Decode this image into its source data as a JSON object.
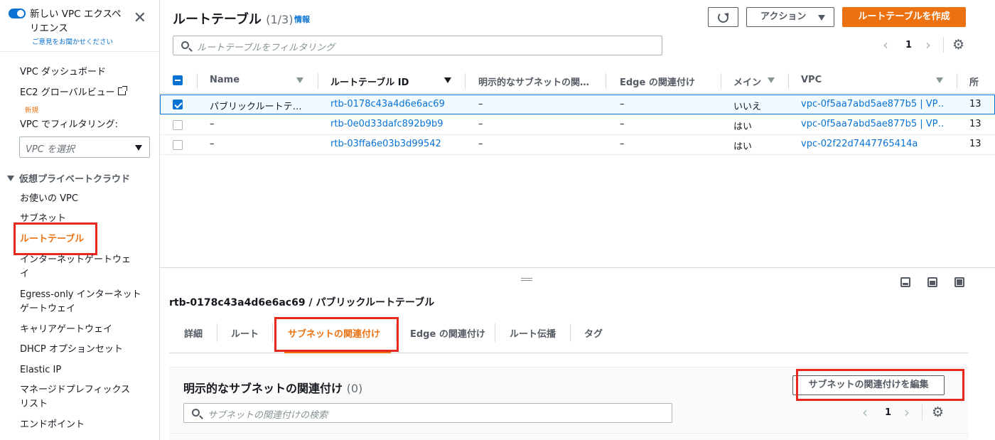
{
  "sidebar": {
    "new_experience_label": "新しい VPC エクスペリエンス",
    "feedback_link": "ご意見をお聞かせください",
    "close_glyph": "✕",
    "dashboard": "VPC ダッシュボード",
    "ec2_global_view": "EC2 グローバルビュー",
    "new_badge": "新規",
    "filter_label": "VPC でフィルタリング:",
    "vpc_select_placeholder": "VPC を選択",
    "section_title": "仮想プライベートクラウド",
    "items": [
      {
        "label": "お使いの VPC"
      },
      {
        "label": "サブネット"
      },
      {
        "label": "ルートテーブル",
        "active": true
      },
      {
        "label": "インターネットゲートウェイ"
      },
      {
        "label": "Egress-only インターネットゲートウェイ"
      },
      {
        "label": "キャリアゲートウェイ"
      },
      {
        "label": "DHCP オプションセット"
      },
      {
        "label": "Elastic IP"
      },
      {
        "label": "マネージドプレフィックスリスト"
      },
      {
        "label": "エンドポイント"
      }
    ]
  },
  "header": {
    "title": "ルートテーブル",
    "count": "(1/3)",
    "info_link": "情報",
    "actions_label": "アクション",
    "create_label": "ルートテーブルを作成",
    "search_placeholder": "ルートテーブルをフィルタリング",
    "page": "1"
  },
  "table": {
    "columns": [
      "Name",
      "ルートテーブル ID",
      "明示的なサブネットの関…",
      "Edge の関連付け",
      "メイン",
      "VPC",
      "所"
    ],
    "rows": [
      {
        "selected": true,
        "name": "パブリックルートテ…",
        "id": "rtb-0178c43a4d6e6ac69",
        "explicit": "–",
        "edge": "–",
        "main": "いいえ",
        "vpc": "vpc-0f5aa7abd5ae877b5 | VP…",
        "owner": "13"
      },
      {
        "selected": false,
        "name": "–",
        "id": "rtb-0e0d33dafc892b9b9",
        "explicit": "–",
        "edge": "–",
        "main": "はい",
        "vpc": "vpc-0f5aa7abd5ae877b5 | VP…",
        "owner": "13"
      },
      {
        "selected": false,
        "name": "–",
        "id": "rtb-03ffa6e03b3d99542",
        "explicit": "–",
        "edge": "–",
        "main": "はい",
        "vpc": "vpc-02f22d7447765414a",
        "owner": "13"
      }
    ]
  },
  "detail": {
    "title": "rtb-0178c43a4d6e6ac69 / パブリックルートテーブル",
    "tabs": [
      {
        "label": "詳細"
      },
      {
        "label": "ルート"
      },
      {
        "label": "サブネットの関連付け",
        "active": true
      },
      {
        "label": "Edge の関連付け"
      },
      {
        "label": "ルート伝播"
      },
      {
        "label": "タグ"
      }
    ],
    "container_title": "明示的なサブネットの関連付け",
    "container_count": "(0)",
    "edit_button": "サブネットの関連付けを編集",
    "search_placeholder": "サブネットの関連付けの検索",
    "page": "1"
  },
  "colors": {
    "accent_orange": "#ec7211",
    "link_blue": "#0972d3",
    "highlight_red": "#e7281e"
  },
  "icons": [
    "toggle-switch",
    "close-icon",
    "external-link-icon",
    "chevron-down-icon",
    "refresh-icon",
    "search-icon",
    "chevron-left-icon",
    "chevron-right-icon",
    "gear-icon",
    "split-panel-icons"
  ]
}
